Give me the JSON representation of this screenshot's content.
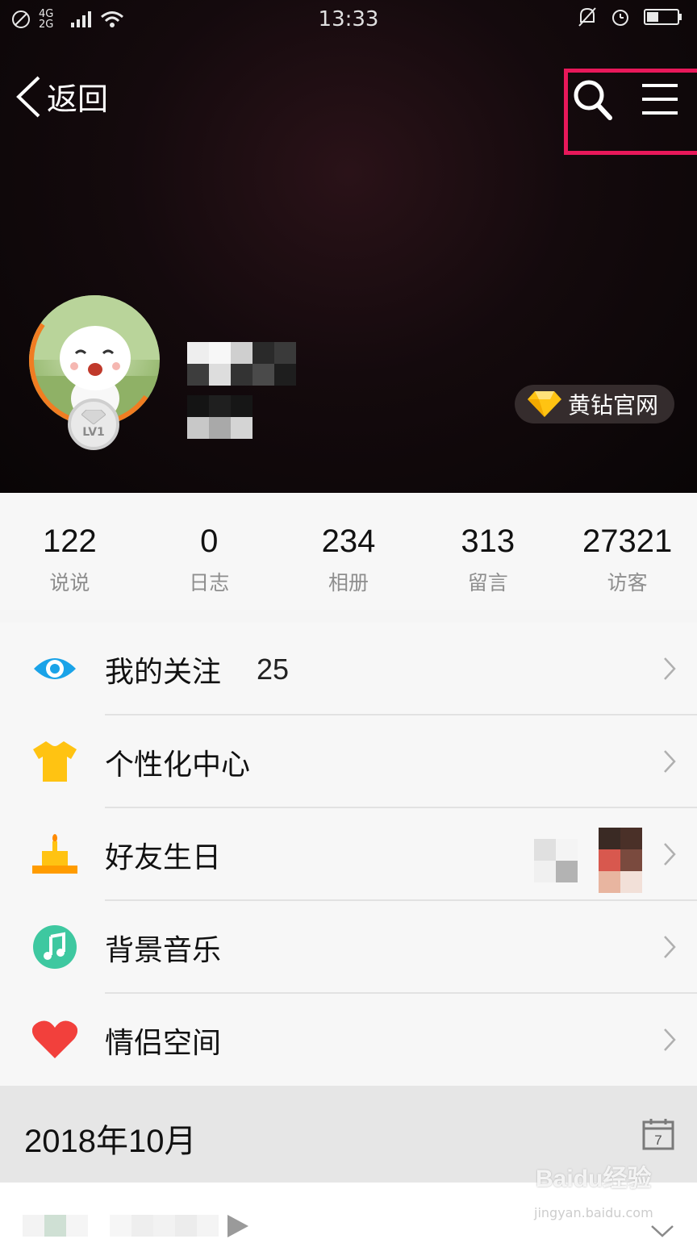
{
  "status_bar": {
    "time": "13:33",
    "network": "4G 2G",
    "signal": "signal-icon",
    "wifi": "wifi-icon"
  },
  "nav": {
    "back_label": "返回"
  },
  "profile": {
    "level_badge": "LV1",
    "vip_label": "黄钻官网"
  },
  "stats": [
    {
      "value": "122",
      "label": "说说"
    },
    {
      "value": "0",
      "label": "日志"
    },
    {
      "value": "234",
      "label": "相册"
    },
    {
      "value": "313",
      "label": "留言"
    },
    {
      "value": "27321",
      "label": "访客"
    }
  ],
  "menu": [
    {
      "label": "我的关注",
      "count": "25",
      "icon": "eye-icon",
      "color": "#1aa3e8"
    },
    {
      "label": "个性化中心",
      "icon": "tshirt-icon",
      "color": "#ffc312"
    },
    {
      "label": "好友生日",
      "icon": "cake-icon",
      "color": "#ffb400"
    },
    {
      "label": "背景音乐",
      "icon": "music-note-icon",
      "color": "#3ec8a0"
    },
    {
      "label": "情侣空间",
      "icon": "heart-icon",
      "color": "#f2403c"
    }
  ],
  "timeline": {
    "date_header": "2018年10月",
    "calendar_day": "7"
  },
  "watermark": {
    "brand": "Baidu经验",
    "url": "jingyan.baidu.com"
  },
  "colors": {
    "highlight_box": "#e8185a",
    "level_ring": "#f07d22",
    "vip_gem": "#ffc312"
  }
}
